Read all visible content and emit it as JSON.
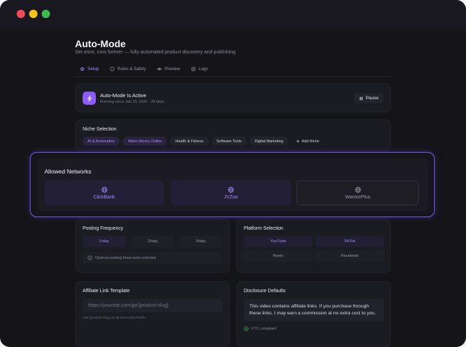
{
  "page": {
    "title": "Auto-Mode",
    "subtitle": "Set once, runs forever — fully automated product discovery and publishing"
  },
  "tabs": [
    {
      "label": "Setup",
      "icon": "gear-icon",
      "active": true
    },
    {
      "label": "Rules & Safety",
      "icon": "shield-icon",
      "active": false
    },
    {
      "label": "Preview",
      "icon": "eye-icon",
      "active": false
    },
    {
      "label": "Logs",
      "icon": "list-icon",
      "active": false
    }
  ],
  "status": {
    "title": "Auto-Mode Is Active",
    "subtitle": "Running since Jan 15, 2026 · 28 days",
    "pause_label": "Pause",
    "icon": "bolt-icon"
  },
  "niche": {
    "label": "Niche Selection",
    "chips": [
      {
        "label": "AI & Automation",
        "selected": true
      },
      {
        "label": "Make Money Online",
        "selected": true
      },
      {
        "label": "Health & Fitness",
        "selected": false
      },
      {
        "label": "Software Tools",
        "selected": false
      },
      {
        "label": "Digital Marketing",
        "selected": false
      }
    ],
    "add_label": "Add Niche"
  },
  "networks": {
    "label": "Allowed Networks",
    "items": [
      {
        "label": "ClickBank",
        "selected": true
      },
      {
        "label": "JVZoo",
        "selected": true
      },
      {
        "label": "WarriorPlus",
        "selected": false
      }
    ]
  },
  "frequency": {
    "label": "Posting Frequency",
    "options": [
      {
        "label": "1/day",
        "selected": true
      },
      {
        "label": "2/day",
        "selected": false
      },
      {
        "label": "3/day",
        "selected": false
      }
    ],
    "note": "Optimal posting times auto-selected"
  },
  "platforms": {
    "label": "Platform Selection",
    "options": [
      {
        "label": "YouTube",
        "selected": true
      },
      {
        "label": "TikTok",
        "selected": true
      },
      {
        "label": "Reels",
        "selected": false
      },
      {
        "label": "Facebook",
        "selected": false
      }
    ]
  },
  "affiliate": {
    "label": "Affiliate Link Template",
    "value": "https://yoursite.com/go/{product-slug}",
    "hint": "Use {product-slug} as dynamic placeholder"
  },
  "disclosure": {
    "label": "Disclosure Defaults",
    "text": "This video contains affiliate links. If you purchase through these links, I may earn a commission at no extra cost to you.",
    "compliance": "FTC compliant"
  },
  "colors": {
    "accent": "#a78bfa",
    "accent_strong": "#8b5cf6",
    "background": "#141419",
    "card": "#1b1b22"
  }
}
